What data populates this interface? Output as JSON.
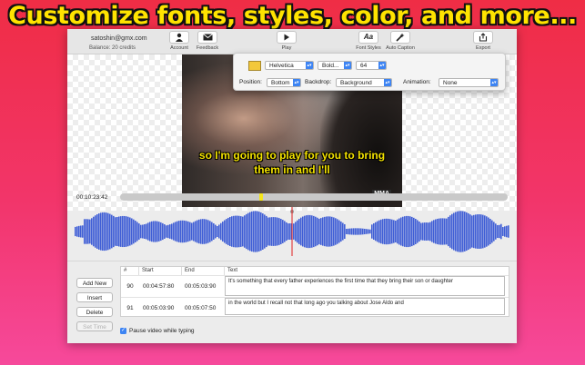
{
  "headline": "Customize fonts, styles, color, and more...",
  "account": {
    "email": "satoshin@gmx.com",
    "balance": "Balance: 20 credits"
  },
  "toolbar": {
    "account_label": "Account",
    "feedback_label": "Feedback",
    "play_label": "Play",
    "font_styles_label": "Font Styles",
    "auto_caption_label": "Auto Caption",
    "export_label": "Export",
    "font_styles_icon_glyph": "Aa"
  },
  "style_popover": {
    "text_color": "#f3c83a",
    "font_family": "Helvetica",
    "font_weight": "Bold...",
    "font_size": "64",
    "position_label": "Position:",
    "position_value": "Bottom",
    "backdrop_label": "Backdrop:",
    "backdrop_value": "Background",
    "animation_label": "Animation:",
    "animation_value": "None"
  },
  "video": {
    "caption_line1": "so I'm going to play for you to bring",
    "caption_line2": "them in and I'll",
    "watermark": "MMA"
  },
  "timeline": {
    "timecode": "00:10:23:42",
    "progress": 0.36,
    "playhead": 0.5
  },
  "buttons": {
    "add_new": "Add New",
    "insert": "Insert",
    "delete": "Delete",
    "set_time": "Set Time"
  },
  "pause_checkbox": {
    "label": "Pause video while typing",
    "checked": true
  },
  "table": {
    "headers": [
      "#",
      "Start",
      "End",
      "Text"
    ],
    "rows": [
      {
        "num": "90",
        "start": "00:04:57:80",
        "end": "00:05:03:90",
        "text": "It's something that every father experiences the first time that they bring their son or daughter"
      },
      {
        "num": "91",
        "start": "00:05:03:90",
        "end": "00:05:07:50",
        "text": "in the world but I recall not that long ago you talking about Jose Aldo and"
      }
    ]
  },
  "colors": {
    "accent": "#3d84f3",
    "caption": "#f3e200",
    "waveform": "#3f5ed6",
    "playhead": "#e02020"
  }
}
